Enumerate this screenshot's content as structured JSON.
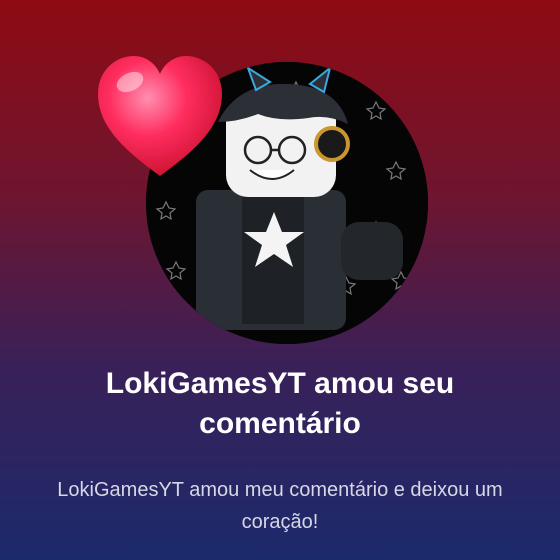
{
  "notification": {
    "title": "LokiGamesYT amou seu comentário",
    "message": "LokiGamesYT amou meu comentário e deixou um coração!",
    "avatar_icon": "roblox-avatar-icon",
    "reaction_icon": "heart-icon",
    "colors": {
      "background_top": "#8e0b13",
      "background_bottom": "#1b2a6c",
      "heart": "#ff2d5f",
      "title_text": "#ffffff",
      "message_text": "#d7d7e6"
    }
  }
}
